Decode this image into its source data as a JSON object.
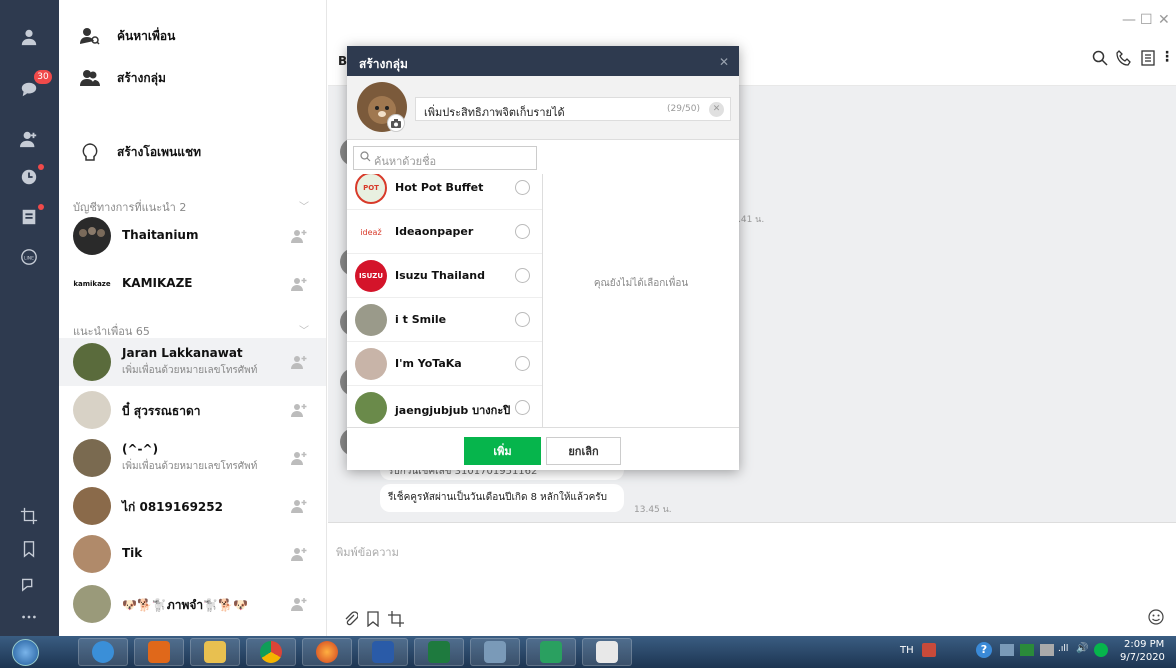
{
  "sidebar": {
    "unread_badge": "30",
    "actions": [
      {
        "label": "ค้นหาเพื่อน",
        "icon": "search-friend-icon"
      },
      {
        "label": "สร้างกลุ่ม",
        "icon": "group-icon"
      },
      {
        "label": "สร้างโอเพนแชท",
        "icon": "openchat-icon"
      }
    ],
    "official_section": "บัญชีทางการที่แนะนำ 2",
    "official": [
      {
        "name": "Thaitanium",
        "avatar_color": "#2a2a2a"
      },
      {
        "name": "KAMIKAZE",
        "avatar_text": "kamikaze"
      }
    ],
    "suggest_section": "แนะนำเพื่อน 65",
    "suggested": [
      {
        "name": "Jaran Lakkanawat",
        "sub": "เพิ่มเพื่อนด้วยหมายเลขโทรศัพท์",
        "avatar_color": "#5a6b3c"
      },
      {
        "name": "บี๋ สุวรรณธาดา",
        "sub": "",
        "avatar_color": "#d8d2c6"
      },
      {
        "name": "(^-^)",
        "sub": "เพิ่มเพื่อนด้วยหมายเลขโทรศัพท์",
        "avatar_color": "#7a6a50"
      },
      {
        "name": "ไก่ 0819169252",
        "sub": "",
        "avatar_color": "#8a6a4a"
      },
      {
        "name": "Tik",
        "sub": "",
        "avatar_color": "#b08a6a"
      },
      {
        "name": "🐶🐕🐩ภาพจำ🐩🐕🐶",
        "sub": "",
        "avatar_color": "#9a9a7a"
      }
    ]
  },
  "chat": {
    "title": "B",
    "messages": [
      {
        "text": "รับกวนเช็คเลข 3101701951162"
      },
      {
        "text": "รีเช็คคูรหัสผ่านเป็นวันเดือนปีเกิด 8 หลักให้แล้วครับ",
        "time": "13.45 น."
      }
    ],
    "time_partial": ".41 น.",
    "input_placeholder": "พิมพ์ข้อความ"
  },
  "dialog": {
    "title": "สร้างกลุ่ม",
    "group_name": "เพิ่มประสิทธิภาพจิตเก็บรายได้",
    "char_count": "(29/50)",
    "search_placeholder": "ค้นหาด้วยชื่อ",
    "contacts": [
      {
        "name": "Hot Pot Buffet",
        "avatar_color": "#e8f0e0",
        "avatar_text": "POT"
      },
      {
        "name": "Ideaonpaper",
        "avatar_color": "#ffffff",
        "avatar_text": "ideaž"
      },
      {
        "name": "Isuzu Thailand",
        "avatar_color": "#d4142a",
        "avatar_text": "ISUZU"
      },
      {
        "name": "i t Smile",
        "avatar_color": "#9a9a8a"
      },
      {
        "name": "I'm YoTaKa",
        "avatar_color": "#c8b4a8"
      },
      {
        "name": "jaengjubjub บางกะปิ",
        "avatar_color": "#6a8a4a"
      }
    ],
    "empty_text": "คุณยังไม่ได้เลือกเพื่อน",
    "ok_label": "เพิ่ม",
    "cancel_label": "ยกเลิก"
  },
  "taskbar": {
    "lang": "TH",
    "time": "2:09 PM",
    "date": "9/7/2020"
  }
}
